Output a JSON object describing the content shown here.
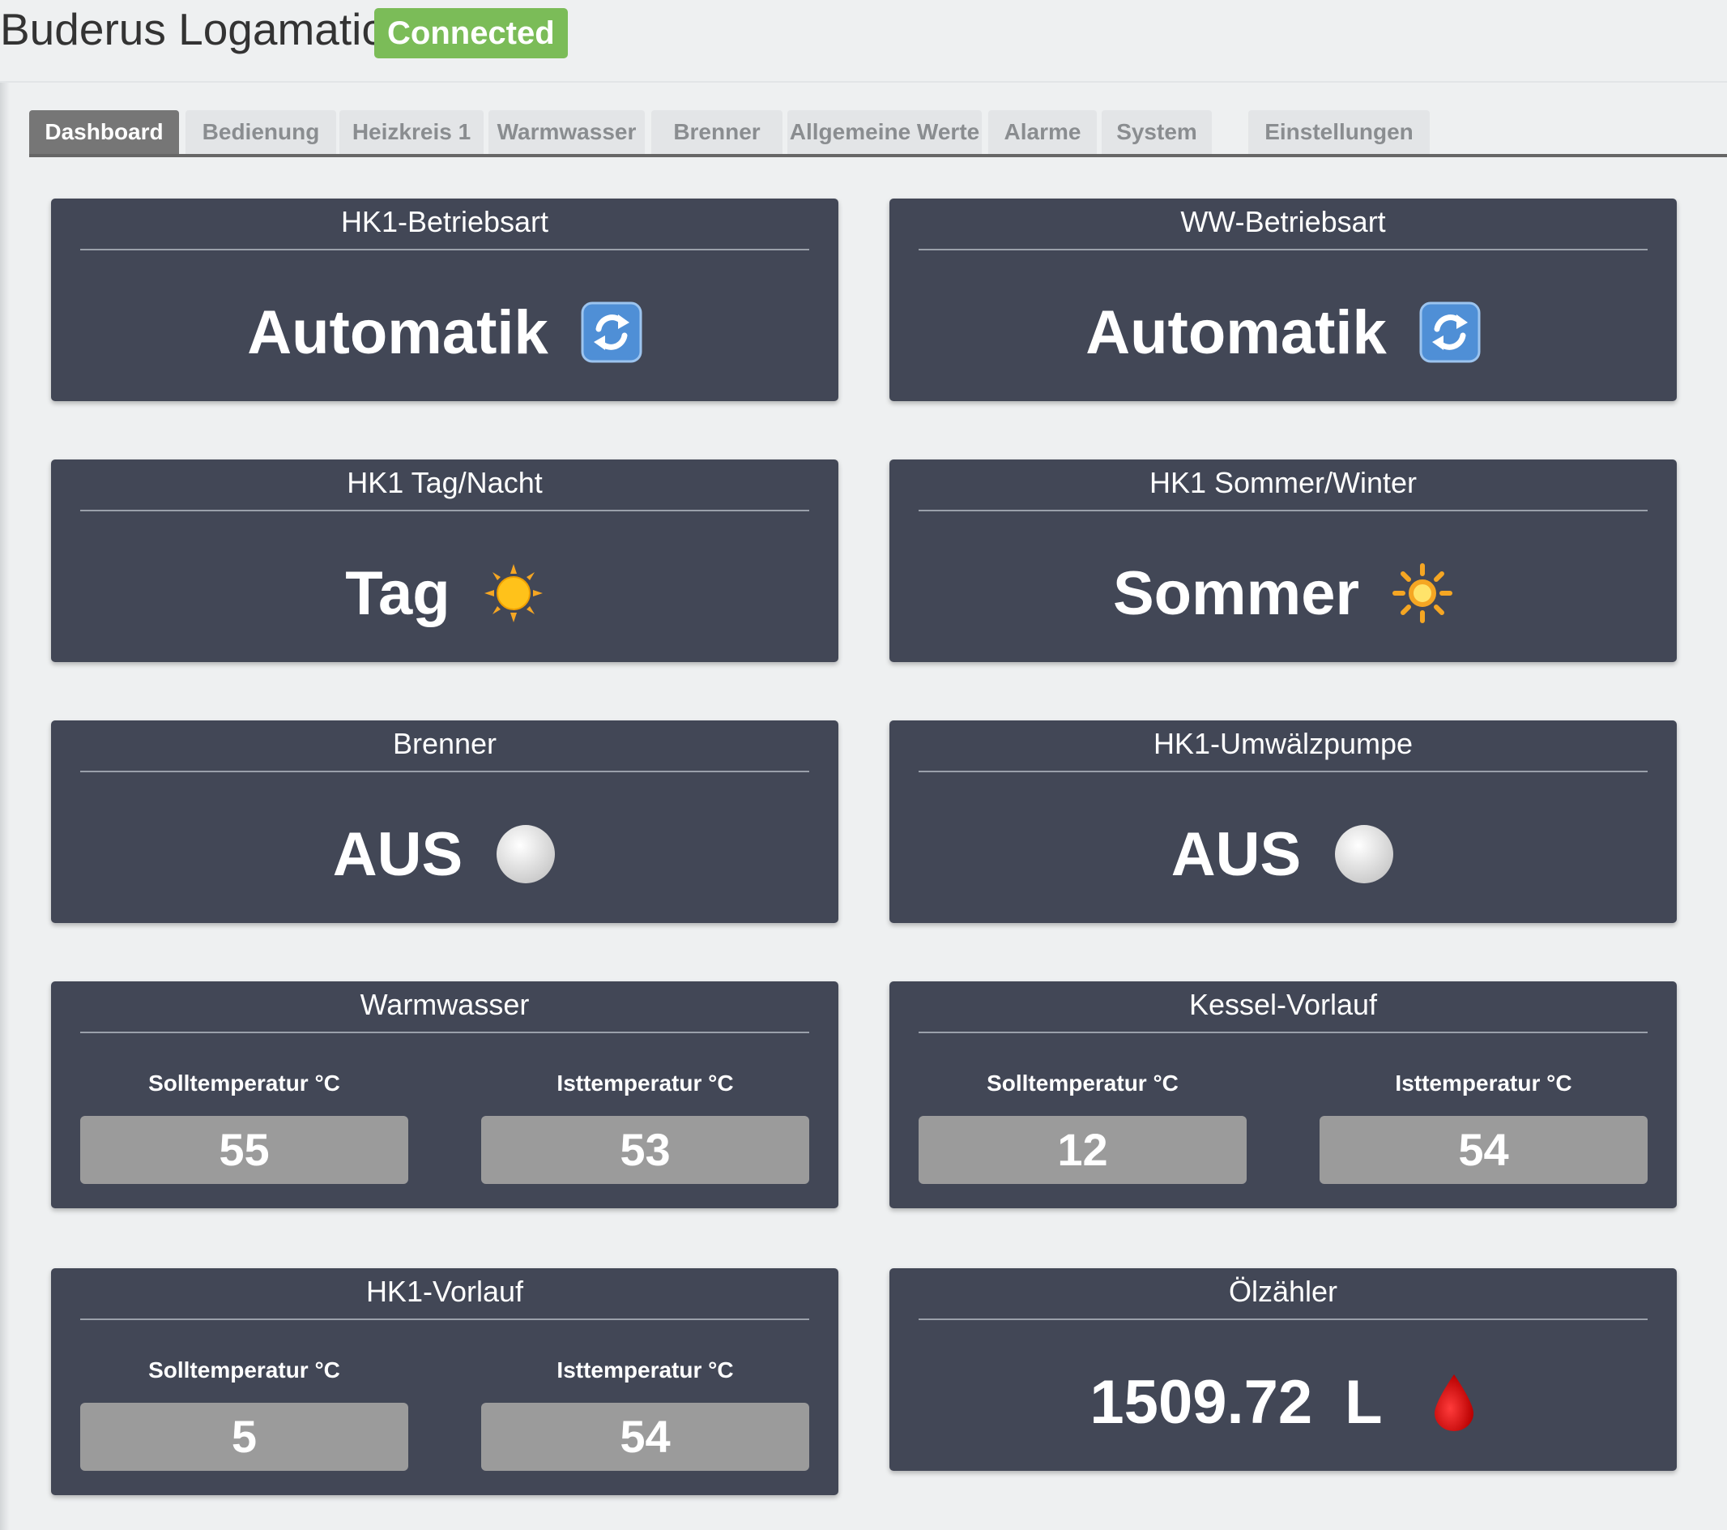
{
  "header": {
    "title": "Buderus Logamatic",
    "status_badge": "Connected"
  },
  "tabs": [
    {
      "label": "Dashboard",
      "active": true
    },
    {
      "label": "Bedienung"
    },
    {
      "label": "Heizkreis 1"
    },
    {
      "label": "Warmwasser"
    },
    {
      "label": "Brenner"
    },
    {
      "label": "Allgemeine Werte"
    },
    {
      "label": "Alarme"
    },
    {
      "label": "System"
    },
    {
      "label": "Einstellungen"
    }
  ],
  "cards": {
    "hk1_betriebsart": {
      "title": "HK1-Betriebsart",
      "value": "Automatik",
      "icon": "refresh-icon"
    },
    "ww_betriebsart": {
      "title": "WW-Betriebsart",
      "value": "Automatik",
      "icon": "refresh-icon"
    },
    "hk1_tag_nacht": {
      "title": "HK1 Tag/Nacht",
      "value": "Tag",
      "icon": "sun-icon"
    },
    "hk1_sommer_winter": {
      "title": "HK1 Sommer/Winter",
      "value": "Sommer",
      "icon": "sun-outline-icon"
    },
    "brenner": {
      "title": "Brenner",
      "value": "AUS",
      "icon": "off-circle-icon"
    },
    "hk1_umwaelzpumpe": {
      "title": "HK1-Umwälzpumpe",
      "value": "AUS",
      "icon": "off-circle-icon"
    },
    "warmwasser": {
      "title": "Warmwasser",
      "soll_label": "Solltemperatur °C",
      "ist_label": "Isttemperatur °C",
      "soll": "55",
      "ist": "53"
    },
    "kessel_vorlauf": {
      "title": "Kessel-Vorlauf",
      "soll_label": "Solltemperatur °C",
      "ist_label": "Isttemperatur °C",
      "soll": "12",
      "ist": "54"
    },
    "hk1_vorlauf": {
      "title": "HK1-Vorlauf",
      "soll_label": "Solltemperatur °C",
      "ist_label": "Isttemperatur °C",
      "soll": "5",
      "ist": "54"
    },
    "oelzaehler": {
      "title": "Ölzähler",
      "value": "1509.72",
      "unit": "L",
      "icon": "oil-drop-icon"
    }
  },
  "colors": {
    "card_bg": "#424756",
    "connected_badge": "#7bbc58",
    "temp_box": "#9b9b9b",
    "active_tab": "#767676"
  }
}
